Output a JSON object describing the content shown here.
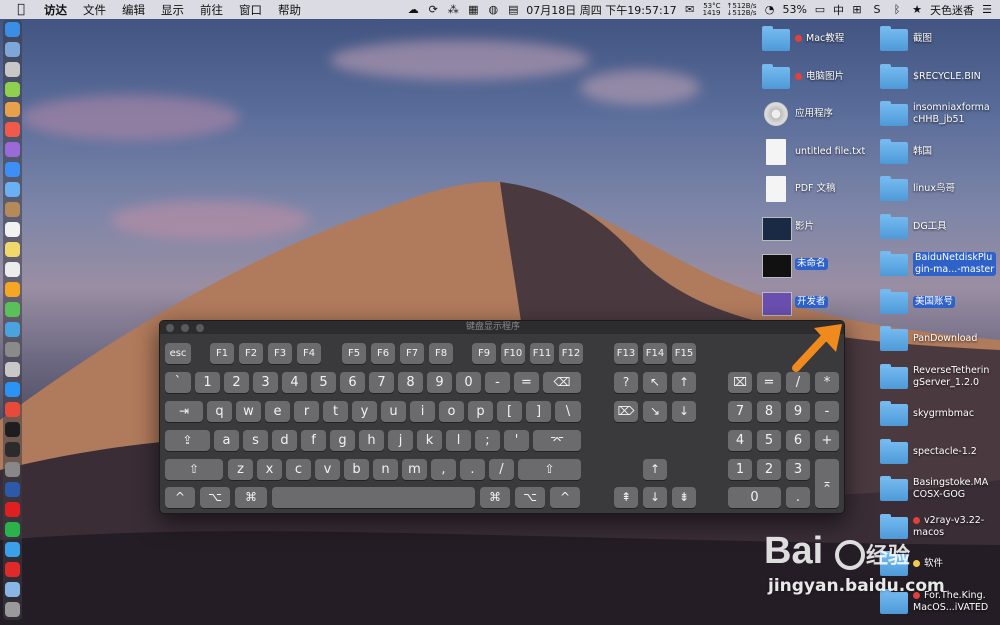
{
  "menubar": {
    "app_name": "访达",
    "menus": [
      "文件",
      "编辑",
      "显示",
      "前往",
      "窗口",
      "帮助"
    ],
    "datetime": "07月18日 周四 下午19:57:17",
    "cpu_temp": "53°C",
    "fan_rpm": "1419",
    "net_up": "↑512B/s",
    "net_down": "↓512B/s",
    "battery": "53%",
    "input_method": "中",
    "user_name": "天色迷香"
  },
  "desktop_icons_left": [
    {
      "label": "Mac教程",
      "tag": "red",
      "kind": "folder"
    },
    {
      "label": "电脑图片",
      "tag": "red",
      "kind": "folder"
    },
    {
      "label": "应用程序",
      "tag": "",
      "kind": "disk"
    },
    {
      "label": "untitled file.txt",
      "tag": "",
      "kind": "doc"
    },
    {
      "label": "PDF 文稿",
      "tag": "",
      "kind": "doc"
    },
    {
      "label": "影片",
      "tag": "",
      "kind": "image"
    },
    {
      "label": "未命名",
      "tag": "",
      "kind": "image",
      "selected": true
    },
    {
      "label": "开发者",
      "tag": "",
      "kind": "image",
      "selected": true
    }
  ],
  "desktop_icons_right": [
    {
      "label": "截图",
      "lines": [
        "截图"
      ]
    },
    {
      "label": "$RECYCLE.BIN",
      "lines": [
        "$RECYCLE.BIN"
      ]
    },
    {
      "label": "insomniaxformacHHB_jb51",
      "lines": [
        "insomniaxforma",
        "cHHB_jb51"
      ]
    },
    {
      "label": "韩国",
      "lines": [
        "韩国"
      ]
    },
    {
      "label": "linux鸟哥",
      "lines": [
        "linux鸟哥"
      ]
    },
    {
      "label": "DG工具",
      "lines": [
        "DG工具"
      ]
    },
    {
      "label": "BaiduNetdiskPlugin-ma...-master",
      "lines": [
        "BaiduNetdiskPlu",
        "gin-ma...-master"
      ],
      "selected": true
    },
    {
      "label": "美国账号",
      "lines": [
        "美国账号"
      ],
      "selected": true
    },
    {
      "label": "PanDownload",
      "lines": [
        "PanDownload"
      ]
    },
    {
      "label": "ReverseTetheringServer_1.2.0",
      "lines": [
        "ReverseTetherin",
        "gServer_1.2.0"
      ]
    },
    {
      "label": "skygrmbmac",
      "lines": [
        "skygrmbmac"
      ]
    },
    {
      "label": "spectacle-1.2",
      "lines": [
        "spectacle-1.2"
      ]
    },
    {
      "label": "Basingstoke.MACOSX-GOG",
      "lines": [
        "Basingstoke.MA",
        "COSX-GOG"
      ]
    },
    {
      "label": "v2ray-v3.22-macos",
      "lines": [
        "v2ray-v3.22-",
        "macos"
      ],
      "tag": "red"
    },
    {
      "label": "软件",
      "lines": [
        "软件"
      ],
      "tag": "yellow"
    },
    {
      "label": "For.The.King.MacOS...iVATED",
      "lines": [
        "For.The.King.",
        "MacOS...iVATED"
      ],
      "tag": "red"
    }
  ],
  "keyboard_viewer": {
    "title": "键盘显示程序",
    "rows": {
      "function": [
        "esc",
        "F1",
        "F2",
        "F3",
        "F4",
        "F5",
        "F6",
        "F7",
        "F8",
        "F9",
        "F10",
        "F11",
        "F12",
        "F13",
        "F14",
        "F15"
      ],
      "number": [
        "`",
        "1",
        "2",
        "3",
        "4",
        "5",
        "6",
        "7",
        "8",
        "9",
        "0",
        "-",
        "=",
        "⌫"
      ],
      "qwerty": [
        "⇥",
        "q",
        "w",
        "e",
        "r",
        "t",
        "y",
        "u",
        "i",
        "o",
        "p",
        "[",
        "]",
        "\\"
      ],
      "asdf": [
        "⇪",
        "a",
        "s",
        "d",
        "f",
        "g",
        "h",
        "j",
        "k",
        "l",
        ";",
        "'",
        "⌤"
      ],
      "zxcv": [
        "⇧",
        "z",
        "x",
        "c",
        "v",
        "b",
        "n",
        "m",
        ",",
        ".",
        "/",
        "⇧"
      ],
      "bottom": [
        "^",
        "⌥",
        "⌘",
        "",
        "⌘",
        "⌥",
        "^"
      ]
    },
    "nav": {
      "row1": [
        "?",
        "↖",
        "↑"
      ],
      "row2": [
        "⌦",
        "↘",
        "↓"
      ],
      "up": "↑",
      "row3": [
        "⇞",
        "↓",
        "⇟"
      ]
    },
    "numpad": {
      "row1": [
        "⌧",
        "=",
        "/",
        "*"
      ],
      "row2": [
        "7",
        "8",
        "9",
        "-"
      ],
      "row3": [
        "4",
        "5",
        "6",
        "+"
      ],
      "row4": [
        "1",
        "2",
        "3"
      ],
      "enter": "⌅",
      "row5": [
        "0",
        "."
      ]
    }
  },
  "watermark": {
    "brand": "Bai 经验",
    "url": "jingyan.baidu.com"
  }
}
